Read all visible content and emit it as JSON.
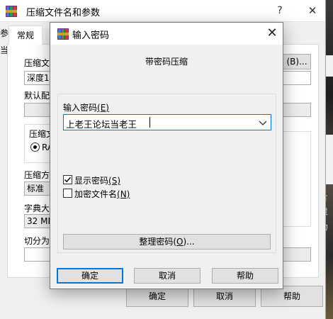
{
  "parent": {
    "title": "压缩文件名和参数",
    "help_glyph": "?",
    "close_glyph": "✕",
    "tab_left_fragment": "参",
    "tab_active": "常规",
    "left_edge_fragment": "当",
    "archive_name_label": "压缩文",
    "browse_button": "(B)...",
    "archive_name_value": "深度1",
    "profile_label": "默认配",
    "format_group_label": "压缩文",
    "radio_fragment": "RA",
    "method_label": "压缩方",
    "method_value": "标准",
    "dict_label": "字典大",
    "dict_value": "32 MB",
    "split_label": "切分为",
    "ok": "确定",
    "cancel": "取消",
    "help": "帮助"
  },
  "dialog": {
    "title": "输入密码",
    "close_glyph": "✕",
    "heading": "带密码压缩",
    "password_label": "输入密码",
    "password_accel": "(E)",
    "password_value": "上老王论坛当老王",
    "show_password": "显示密码",
    "show_password_accel": "(S)",
    "show_password_checked": true,
    "encrypt_names": "加密文件名",
    "encrypt_names_accel": "(N)",
    "encrypt_names_checked": false,
    "organize_button": "整理密码(",
    "organize_accel": "O",
    "organize_suffix": ")...",
    "ok": "确定",
    "cancel": "取消",
    "help": "帮助"
  },
  "background_strip": {
    "text1": "片",
    "text2": "灵",
    "text3": "力"
  }
}
